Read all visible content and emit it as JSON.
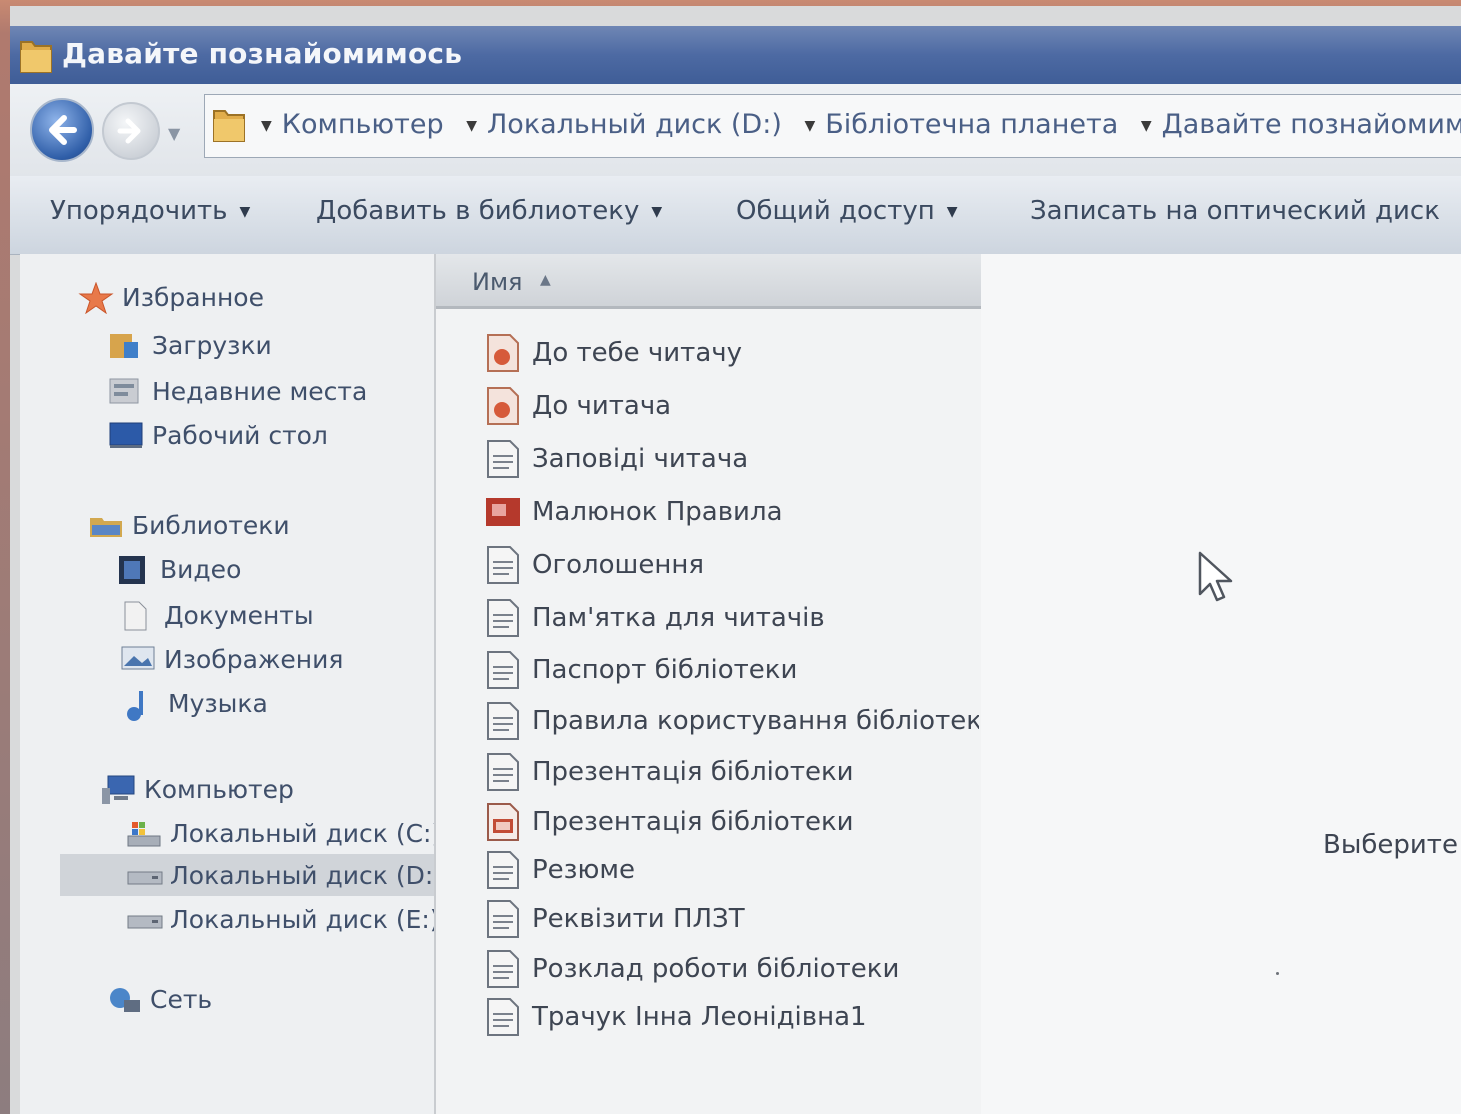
{
  "window": {
    "title": "Давайте познайомимось"
  },
  "address": {
    "crumbs": [
      "Компьютер",
      "Локальный диск (D:)",
      "Бібліотечна планета",
      "Давайте познайомимос"
    ]
  },
  "toolbar": {
    "organize": "Упорядочить",
    "add_to_library": "Добавить в библиотеку",
    "share": "Общий доступ",
    "burn": "Записать на оптический диск"
  },
  "nav": {
    "favorites": "Избранное",
    "downloads": "Загрузки",
    "recent": "Недавние места",
    "desktop": "Рабочий стол",
    "libraries": "Библиотеки",
    "video": "Видео",
    "documents": "Документы",
    "images": "Изображения",
    "music": "Музыка",
    "computer": "Компьютер",
    "disk_c": "Локальный диск (C:)",
    "disk_d": "Локальный диск (D:)",
    "disk_e": "Локальный диск (E:)",
    "network": "Сеть"
  },
  "filelist": {
    "column_name": "Имя",
    "files": [
      {
        "name": "До тебе читачу",
        "icon": "presentation-icon"
      },
      {
        "name": "До читача",
        "icon": "presentation-icon"
      },
      {
        "name": "Заповіді читача",
        "icon": "document-icon"
      },
      {
        "name": "Малюнок Правила",
        "icon": "image-icon"
      },
      {
        "name": "Оголошення",
        "icon": "document-icon"
      },
      {
        "name": "Пам'ятка для читачів",
        "icon": "document-icon"
      },
      {
        "name": "Паспорт бібліотеки",
        "icon": "document-icon"
      },
      {
        "name": "Правила користування бібліотеко",
        "icon": "document-icon"
      },
      {
        "name": "Презентація бібліотеки",
        "icon": "document-icon"
      },
      {
        "name": "Презентація бібліотеки",
        "icon": "slides-icon"
      },
      {
        "name": "Резюме",
        "icon": "document-icon"
      },
      {
        "name": "Реквізити ПЛЗТ",
        "icon": "document-icon"
      },
      {
        "name": "Розклад роботи бібліотеки",
        "icon": "document-icon"
      },
      {
        "name": "Трачук Інна Леонідівна1",
        "icon": "document-icon"
      }
    ]
  },
  "preview": {
    "message": "Выберите"
  },
  "colors": {
    "titlebar": "#4d6aa3",
    "link_text": "#4a5f86",
    "text": "#3e4552"
  }
}
